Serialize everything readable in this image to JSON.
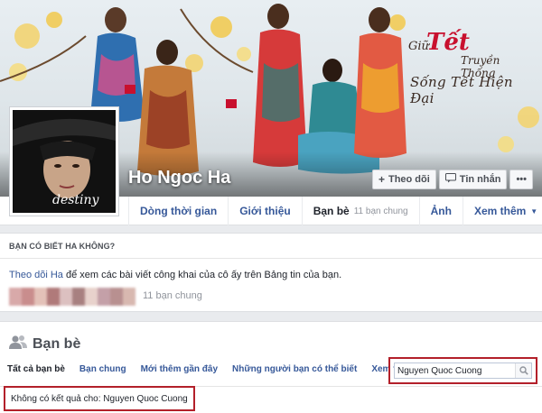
{
  "cover": {
    "promo": {
      "line1": "Giữ",
      "tet": "Tết",
      "line2": "Truyền Thống",
      "line3": "Sống Tết Hiện Đại"
    }
  },
  "profile": {
    "name": "Ho Ngoc Ha",
    "picture_caption": "destiny"
  },
  "actions": {
    "follow": "Theo dõi",
    "message": "Tin nhắn",
    "more": "•••"
  },
  "timeline_tabs": [
    {
      "label": "Dòng thời gian"
    },
    {
      "label": "Giới thiệu"
    },
    {
      "label": "Bạn bè",
      "count": "11 bạn chung"
    },
    {
      "label": "Ảnh"
    },
    {
      "label": "Xem thêm"
    }
  ],
  "know": {
    "title": "BẠN CÓ BIẾT HA KHÔNG?",
    "follow_link": "Theo dõi Ha",
    "text_rest": " để xem các bài viết công khai của cô ấy trên Bảng tin của bạn.",
    "mutual": "11 bạn chung"
  },
  "friends": {
    "title": "Bạn bè",
    "tabs": [
      "Tất cả bạn bè",
      "Bạn chung",
      "Mới thêm gần đây",
      "Những người bạn có thể biết",
      "Xem thêm"
    ],
    "search_value": "Nguyen Quoc Cuong",
    "no_result": "Không có kết quả cho: Nguyen Quoc Cuong"
  },
  "colors": {
    "link": "#365899",
    "highlight": "#b3202a",
    "promo_red": "#c8102e"
  },
  "icons": {
    "follow": "plus-icon",
    "message": "message-icon",
    "more": "ellipsis-icon",
    "friends": "people-icon",
    "search": "search-icon",
    "tab_more": "caret-down-icon"
  }
}
